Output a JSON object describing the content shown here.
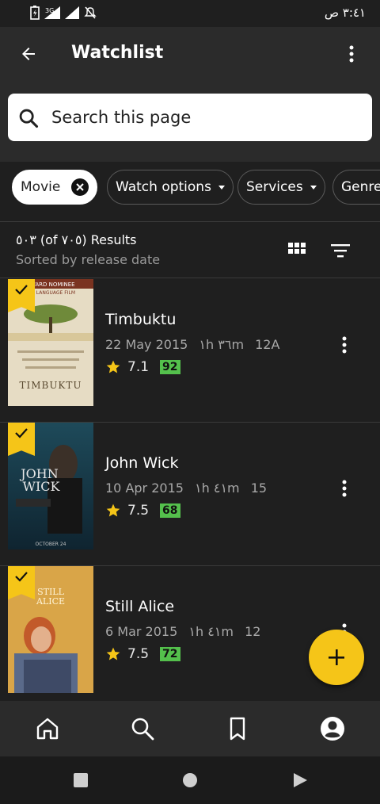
{
  "status_bar": {
    "time": "٣:٤١ ص",
    "network_label": "3G",
    "icons": [
      "battery-icon",
      "signal-icon",
      "signal-icon",
      "mute-icon"
    ]
  },
  "header": {
    "title": "Watchlist",
    "back_icon": "arrow-back-icon",
    "overflow_icon": "more-vertical-icon"
  },
  "search": {
    "placeholder": "Search this page"
  },
  "filters": [
    {
      "label": "Movie",
      "active": true
    },
    {
      "label": "Watch options",
      "active": false
    },
    {
      "label": "Services",
      "active": false
    },
    {
      "label": "Genres",
      "active": false
    }
  ],
  "results": {
    "count_text": "٥٠٣ (of ٧٠٥) Results",
    "sort_text": "Sorted by release date"
  },
  "items": [
    {
      "title": "Timbuktu",
      "date": "22 May 2015",
      "runtime": "١h ٣٦m",
      "certificate": "12A",
      "rating": "7.1",
      "metascore": "92",
      "poster_text": "TIMBUKTU",
      "poster_banner": "AWARD NOMINEE",
      "poster_banner2": "IGN LANGUAGE FILM"
    },
    {
      "title": "John Wick",
      "date": "10 Apr 2015",
      "runtime": "١h ٤١m",
      "certificate": "15",
      "rating": "7.5",
      "metascore": "68",
      "poster_text_1": "JOHN",
      "poster_text_2": "WICK",
      "poster_footer": "OCTOBER 24"
    },
    {
      "title": "Still Alice",
      "date": "6 Mar 2015",
      "runtime": "١h ٤١m",
      "certificate": "12",
      "rating": "7.5",
      "metascore": "72",
      "poster_text_1": "STILL",
      "poster_text_2": "ALICE"
    }
  ],
  "bottom_nav": [
    {
      "name": "home-icon"
    },
    {
      "name": "search-icon"
    },
    {
      "name": "bookmark-icon"
    },
    {
      "name": "profile-icon"
    }
  ],
  "colors": {
    "accent": "#f5c518",
    "metascore": "#54c04c",
    "background": "#1f1f1f",
    "surface": "#2b2b2b"
  }
}
